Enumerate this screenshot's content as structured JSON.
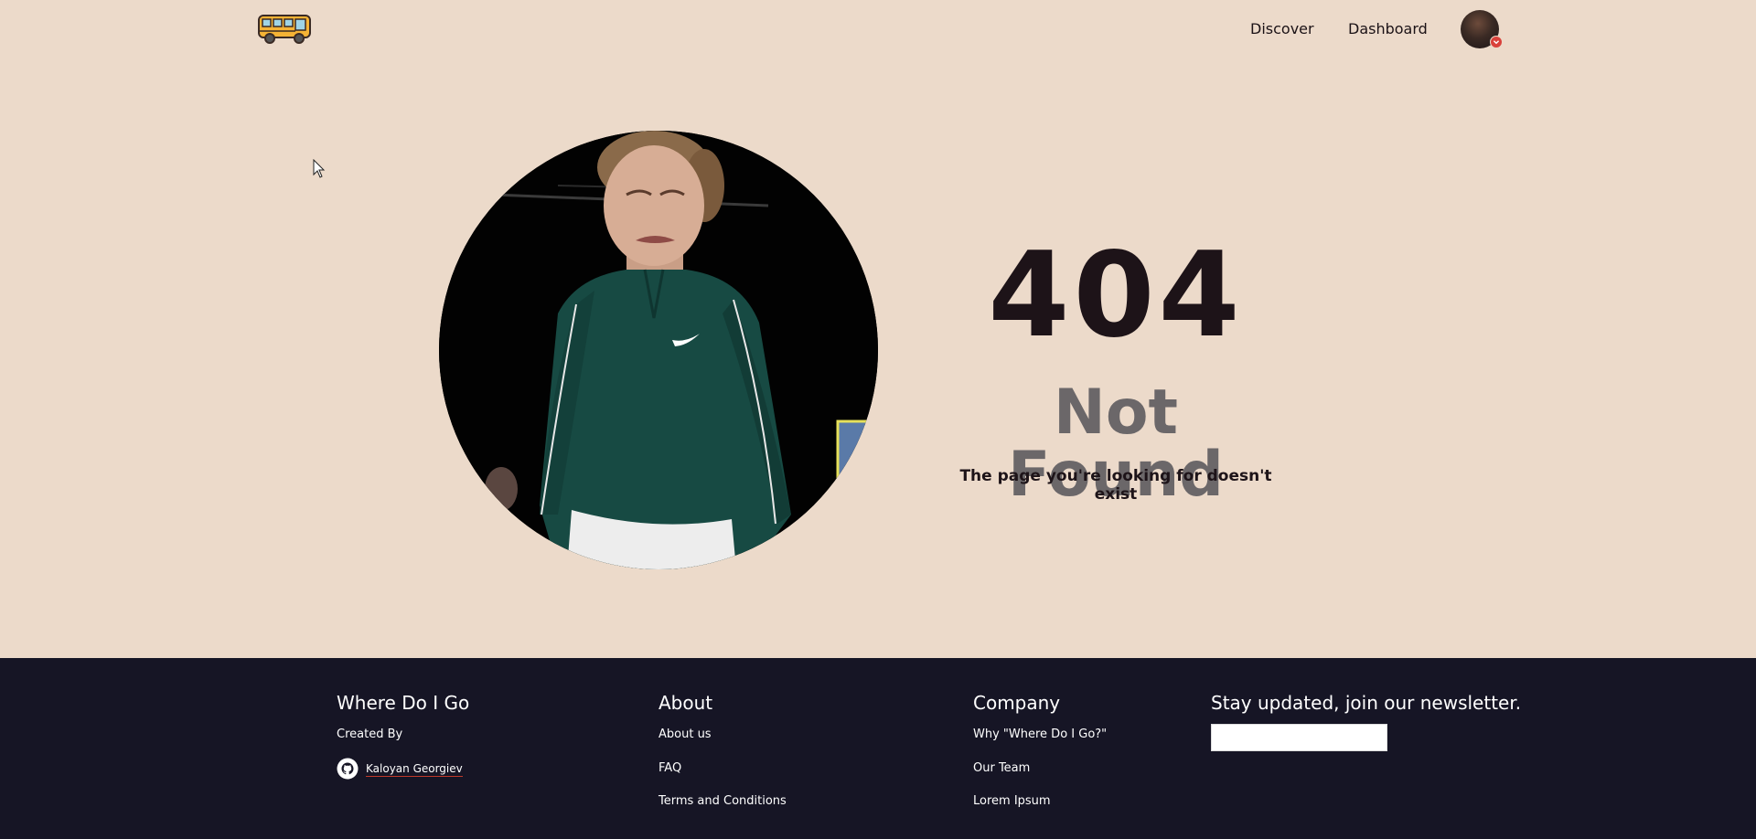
{
  "header": {
    "logo_icon": "school-bus-icon",
    "nav": [
      {
        "label": "Discover"
      },
      {
        "label": "Dashboard"
      }
    ],
    "avatar_icon": "user-avatar",
    "avatar_badge_icon": "chevron-down-icon"
  },
  "hero": {
    "image_icon": "tennis-player-photo",
    "code": "404",
    "title": "Not Found",
    "message": "The page you're looking for doesn't exist"
  },
  "footer": {
    "brand": {
      "title": "Where Do I Go",
      "created_by": "Created By",
      "author": "Kaloyan Georgiev",
      "author_icon": "github-icon"
    },
    "about": {
      "title": "About",
      "links": [
        "About us",
        "FAQ",
        "Terms and Conditions"
      ]
    },
    "company": {
      "title": "Company",
      "links": [
        "Why \"Where Do I Go?\"",
        "Our Team",
        "Lorem Ipsum"
      ]
    },
    "newsletter": {
      "title": "Stay updated, join our newsletter.",
      "value": ""
    }
  },
  "colors": {
    "background": "#ecdaca",
    "footer_background": "#161525",
    "code_text": "#1d1318",
    "title_text": "#6b6769",
    "badge": "#d9413b"
  }
}
